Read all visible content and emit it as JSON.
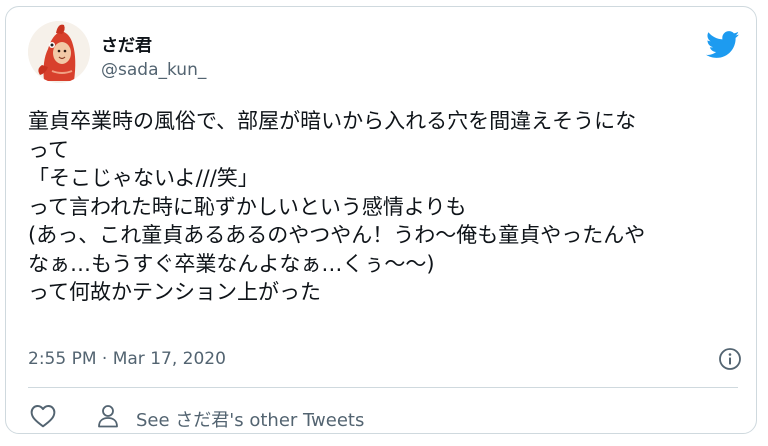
{
  "user": {
    "display_name": "さだ君",
    "username": "@sada_kun_",
    "avatar_icon": "avatar-fish-costume"
  },
  "tweet": {
    "lines": [
      "童貞卒業時の風俗で、部屋が暗いから入れる穴を間違えそうにな",
      "って",
      "「そこじゃないよ///笑」",
      "って言われた時に恥ずかしいという感情よりも",
      "(あっ、これ童貞あるあるのやつやん！うわ〜俺も童貞やったんや",
      "なぁ…もうすぐ卒業なんよなぁ…くぅ〜〜)",
      "って何故かテンション上がった"
    ],
    "timestamp": "2:55 PM · Mar 17, 2020"
  },
  "footer": {
    "see_tweets": "See さだ君's other Tweets"
  },
  "icons": {
    "brand": "twitter-bird-icon",
    "info": "info-icon",
    "like": "heart-icon",
    "profile": "person-icon"
  },
  "colors": {
    "brand_blue": "#1d9bf0",
    "secondary_text": "#536471",
    "border": "#cfd9de"
  }
}
